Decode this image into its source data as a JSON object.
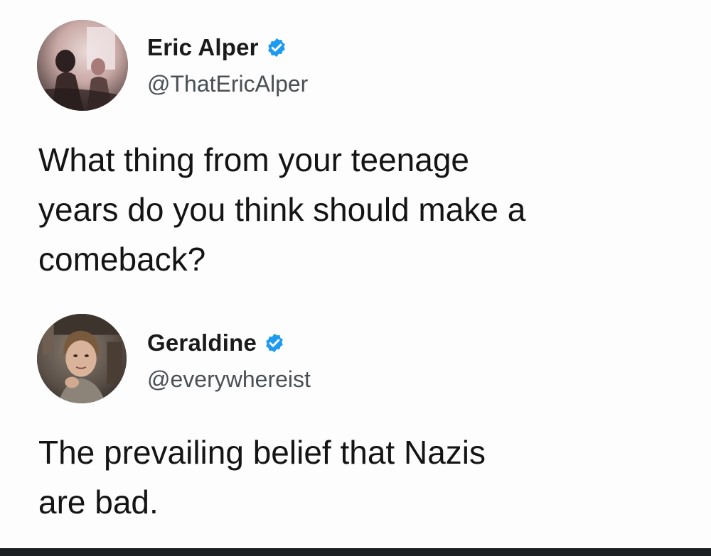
{
  "tweets": [
    {
      "author": {
        "display_name": "Eric Alper",
        "handle": "@ThatEricAlper",
        "verified": true,
        "avatar": "profile-photo"
      },
      "text_lines": [
        "What thing from your teenage",
        "years do you think should make a",
        "comeback?"
      ]
    },
    {
      "author": {
        "display_name": "Geraldine",
        "handle": "@everywhereist",
        "verified": true,
        "avatar": "profile-photo"
      },
      "text_lines": [
        "The prevailing belief that Nazis",
        "are bad."
      ]
    }
  ],
  "colors": {
    "verified_badge": "#1d9bf0",
    "background": "#fdfdfd",
    "text": "#141414",
    "handle": "#4a4f54",
    "bottom_bar": "#1b1f22"
  },
  "icons": {
    "verified": "verified-badge-icon"
  }
}
